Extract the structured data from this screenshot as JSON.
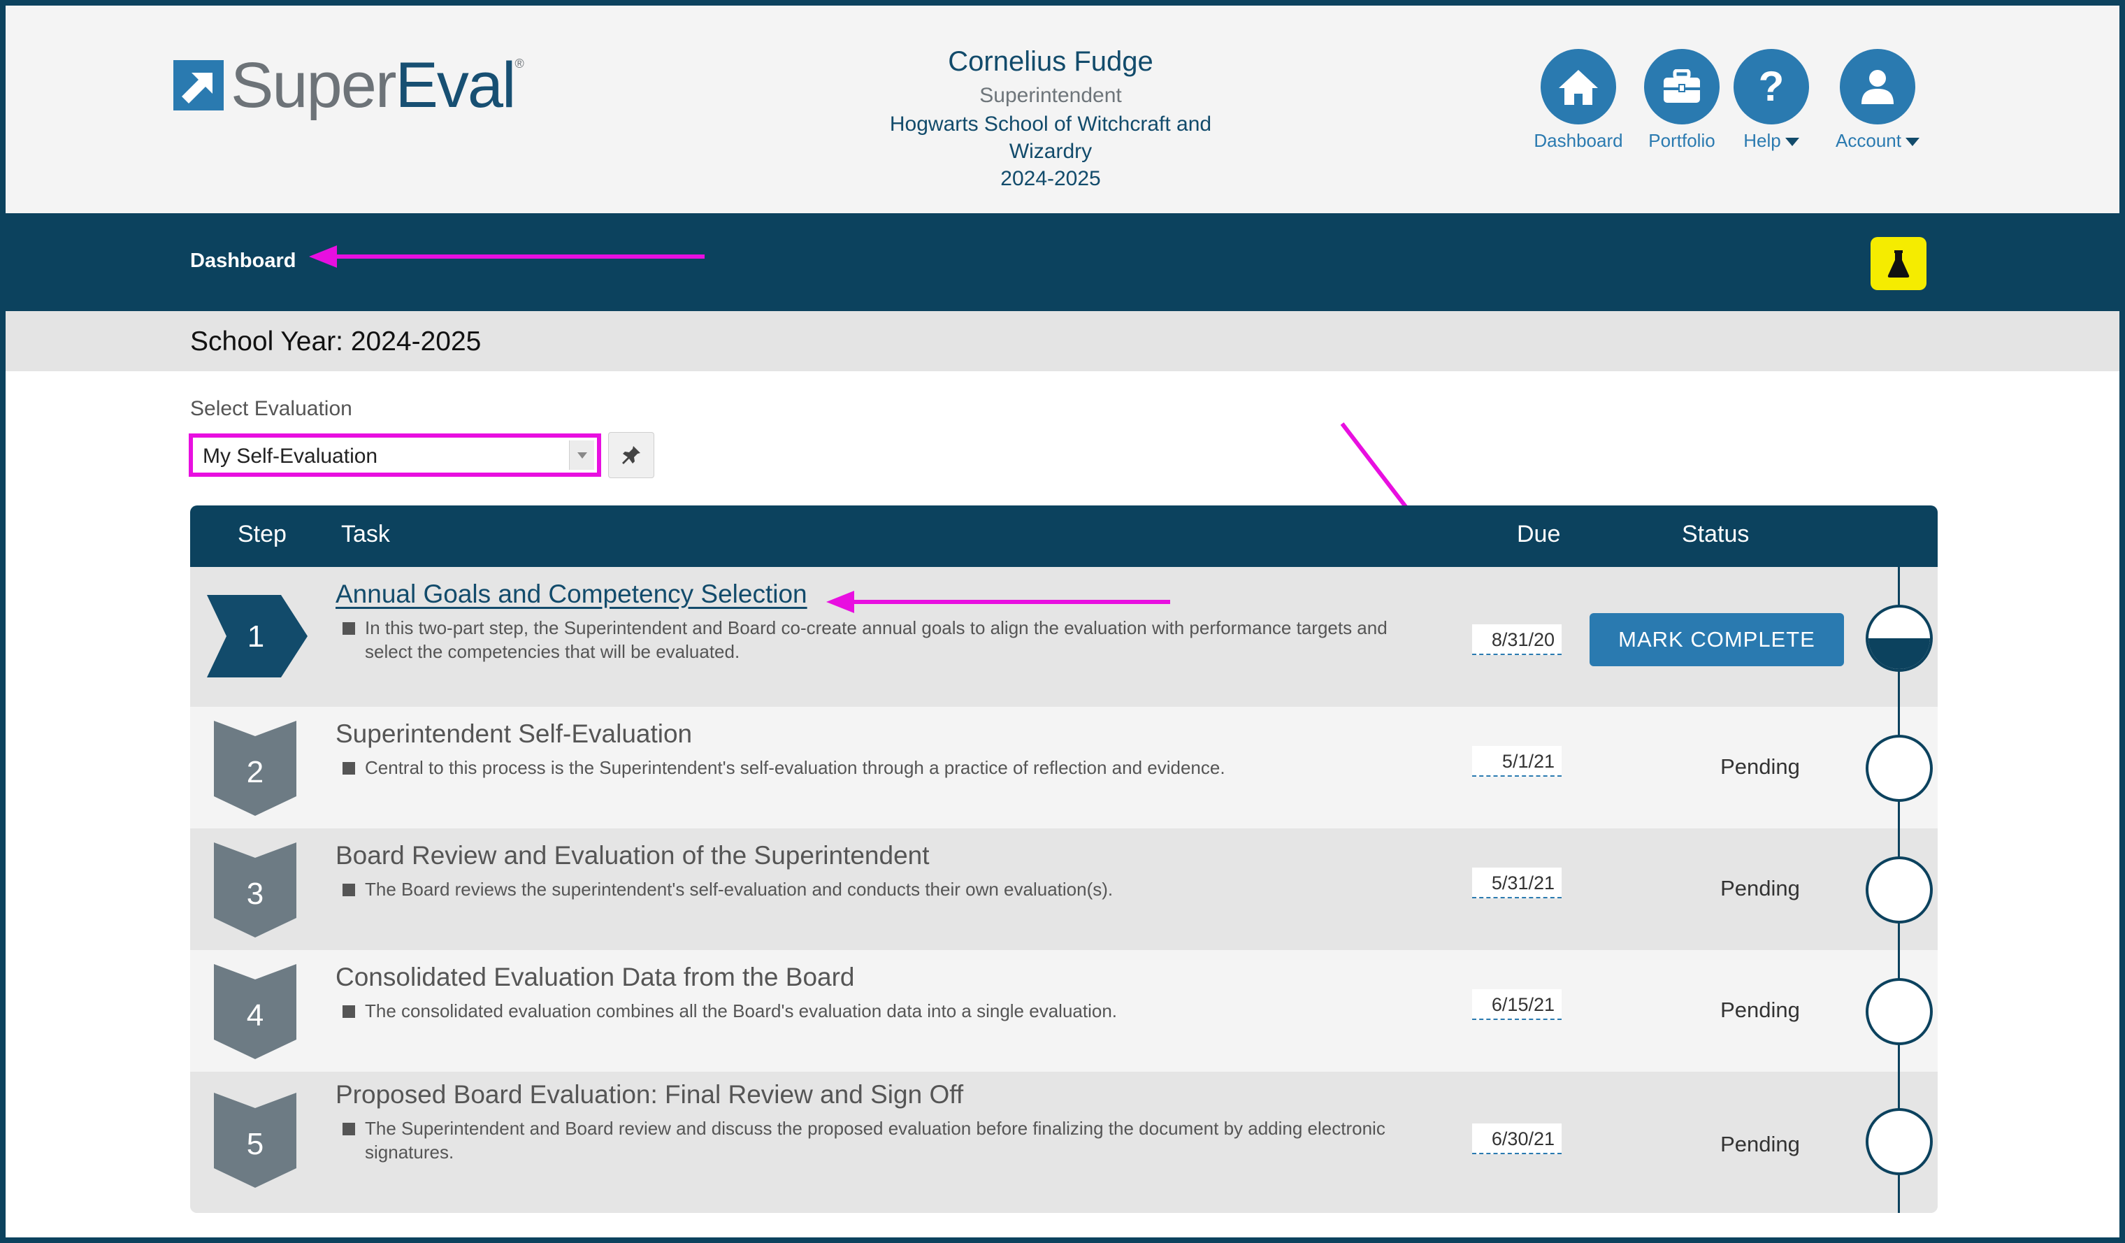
{
  "brand": {
    "name_part1": "Super",
    "name_part2": "Eval",
    "trademark": "®"
  },
  "user": {
    "name": "Cornelius Fudge",
    "role": "Superintendent",
    "school_line1": "Hogwarts School of Witchcraft and",
    "school_line2": "Wizardry",
    "year": "2024-2025"
  },
  "nav": {
    "dashboard": "Dashboard",
    "portfolio": "Portfolio",
    "help": "Help",
    "account": "Account"
  },
  "breadcrumb": "Dashboard",
  "school_year": "School Year: 2024-2025",
  "select": {
    "label": "Select Evaluation",
    "value": "My Self-Evaluation"
  },
  "table": {
    "headers": {
      "step": "Step",
      "task": "Task",
      "due": "Due",
      "status": "Status"
    },
    "rows": [
      {
        "step": "1",
        "title": "Annual Goals and Competency Selection",
        "desc": "In this two-part step, the Superintendent and Board co-create annual goals to align the evaluation with performance targets and select the competencies that will be evaluated.",
        "due": "8/31/20",
        "action": "MARK COMPLETE",
        "progress": 0.5
      },
      {
        "step": "2",
        "title": "Superintendent Self-Evaluation",
        "desc": "Central to this process is the Superintendent's self-evaluation through a practice of reflection and evidence.",
        "due": "5/1/21",
        "status": "Pending",
        "progress": 0
      },
      {
        "step": "3",
        "title": "Board Review and Evaluation of the Superintendent",
        "desc": "The Board reviews the superintendent's self-evaluation and conducts their own evaluation(s).",
        "due": "5/31/21",
        "status": "Pending",
        "progress": 0
      },
      {
        "step": "4",
        "title": "Consolidated Evaluation Data from the Board",
        "desc": "The consolidated evaluation combines all the Board's evaluation data into a single evaluation.",
        "due": "6/15/21",
        "status": "Pending",
        "progress": 0
      },
      {
        "step": "5",
        "title": "Proposed Board Evaluation: Final Review and Sign Off",
        "desc": "The Superintendent and Board review and discuss the proposed evaluation before finalizing the document by adding electronic signatures.",
        "due": "6/30/21",
        "status": "Pending",
        "progress": 0
      }
    ]
  },
  "colors": {
    "navy": "#0c425e",
    "accent": "#2a7ab0",
    "annotation": "#e80fe0",
    "lab": "#f5ec00"
  }
}
